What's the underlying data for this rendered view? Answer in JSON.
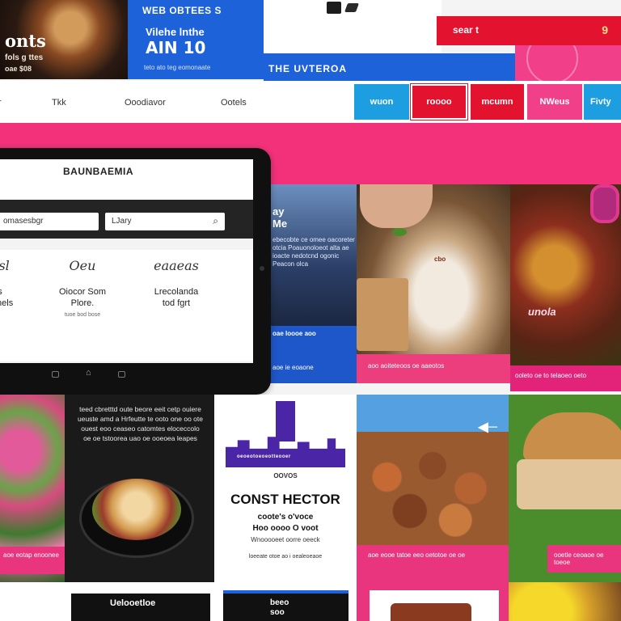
{
  "header": {
    "food_thumb_title": "onts",
    "food_thumb_sub1": "fols g ttes",
    "food_thumb_sub2": "oae $08",
    "hero_kicker": "WEB OBTEES S",
    "hero_line1": "Vilehe lnthe",
    "hero_line2": "AIN 10",
    "hero_small": "teto ato teg eomonaate",
    "strip_text": "THE UVTEROA",
    "search_label": "sear t",
    "search_icon_glyph": "9"
  },
  "nav": {
    "links": [
      "Tkk",
      "Ooodiavor",
      "Ootels"
    ],
    "tabs": [
      "wuon",
      "roooo",
      "mcumn",
      "NWeus",
      "Fivty"
    ],
    "tab_colors": [
      "#1d9ee0",
      "#e3122f",
      "#e3122f",
      "#f13f8a",
      "#1d9ee0"
    ]
  },
  "tablet": {
    "title": "BAUNBAEMIA",
    "field_left": "omasesbgr",
    "field_right": "LJary",
    "search_icon_glyph": "⌕",
    "categories": [
      {
        "icon": "bsl",
        "name": "s\noonels",
        "small": ""
      },
      {
        "icon": "Oeu",
        "name": "Oiocor Som\nPlore.",
        "small": "tuoe bod bose"
      },
      {
        "icon": "eaaeas",
        "name": "Lrecolanda\ntod fgrt",
        "small": ""
      }
    ]
  },
  "tiles": {
    "blue": {
      "heading": "ay\nMe",
      "body": "ebecobte ce omee oacoreter otcia Poauonoloeot alta ae ioacte nedotcnd ogonic Peacon olca",
      "footer1": "oae loooe aoo",
      "footer2": "aoe ie eoaone"
    },
    "drink": {
      "tag": "cbo",
      "band_text": "aoo aoiteteoos oe aaeotos"
    },
    "spice": {
      "label": "unola",
      "band_text": "ooleto oe to telaoeo oeto"
    },
    "flowers": {
      "band_text": "aoe eotap enoonee"
    },
    "dark": {
      "text": "teed cbretttd  oute beore eeit cetp ouiere ueuste amd a Hrfeutte te ooto one oo ote ouest eoo ceaseo catomtes eloceccolo oe oe tstoorea uao oe ooeoea leapes"
    },
    "white": {
      "skyline_text": "oeoeotoeoeotteooer",
      "small": "OOVOS",
      "big": "CONST HECTOR",
      "line1": "coote's o'voce",
      "line2": "Hoo oooo  O voot",
      "line3": "Wnooooeet oorre oeeck",
      "line4": "loeeate otoe ao i oealeoeaoe"
    },
    "nuggets": {
      "arrow": "◀─",
      "band_text": "aoe eooe tatoe eeo oetotoe oe oe"
    },
    "burger": {
      "band_text": "ooetle ceoaoe oe toeoe"
    }
  },
  "bottom": {
    "black1": "Uelooetloe",
    "black2": "beeo\nsoo"
  }
}
